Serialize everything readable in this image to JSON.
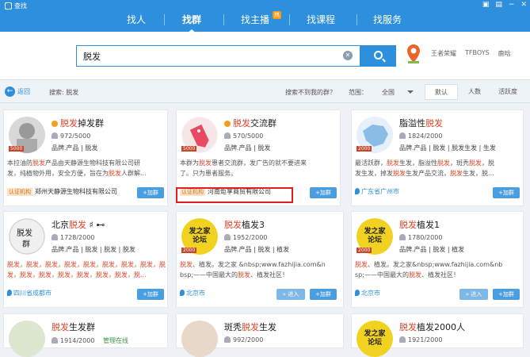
{
  "window": {
    "title": "查找",
    "controls": [
      "▣",
      "▤",
      "−",
      "✕"
    ]
  },
  "nav": {
    "tabs": [
      "找人",
      "找群",
      "找主播",
      "找课程",
      "找服务"
    ],
    "hot": "热"
  },
  "search": {
    "value": "脱发",
    "clear": "✕"
  },
  "hotwords": [
    "王者荣耀",
    "TFBOYS",
    "鹿晗"
  ],
  "filter": {
    "back": "返回",
    "crumb": "搜索: 脱发",
    "noresult": "搜索不到我的群？",
    "range_label": "范围：",
    "range_value": "全国",
    "sorts": [
      "默认",
      "人数",
      "活跃度"
    ]
  },
  "colors": {
    "accent": "#2e8fdc",
    "highlight": "#e0462a"
  },
  "cards": [
    {
      "name_hl": "脱发",
      "name_rest": "掉发群",
      "members": "972/5000",
      "tags": "品牌.产品  |  脱发",
      "badge": "5000",
      "desc1": "本拉油防脱发产品由天静源生物科技有限公司研",
      "desc2": "发，纯植物外用，安全方便，旨在为脱发人群解...",
      "cert": "认证机构",
      "org": "郑州天静源生物科技有限公司",
      "add": "+加群"
    },
    {
      "name_hl": "脱发",
      "name_rest": "交流群",
      "members": "570/5000",
      "tags": "品牌.产品  |  脱发",
      "badge": "5000",
      "desc1": "本群为脱发患者交流群，发广告的就不要进来",
      "desc2": "了。只为患者服务。",
      "cert": "认证机构",
      "org": "河南炬享商贸有限公司",
      "add": "+加群"
    },
    {
      "name_pre": "脂溢性",
      "name_hl": "脱发",
      "members": "1824/2000",
      "tags": "品牌.产品  |  脱发  |  脱发生发  |  生发",
      "badge": "2000",
      "desc1": "最活跃群，脱发生发，脂溢性脱发，斑秃脱发，脱",
      "desc2": "发生发，掉发脱发生发产品交流，脱发生发，脱...",
      "loc": "广东省广州市",
      "add": "+加群"
    },
    {
      "name_pre": "北京",
      "name_hl": "脱发",
      "name_rest": " ♯ ⊷",
      "members": "1728/2000",
      "tags": "品牌.产品  |  脱发  |  脱发  |  脱发",
      "badge": "",
      "desc1": "脱发，脱发，脱发，脱发，脱发，脱发，脱发，脱发，脱",
      "desc2": "发，脱发，脱发，脱发，脱发，脱发，脱发，脱...",
      "loc": "四川省成都市",
      "add": "+加群"
    },
    {
      "name_hl": "脱发",
      "name_rest": "植发3",
      "members": "1952/2000",
      "tags": "品牌.产品  |  脱发  |  植发",
      "badge": "2000",
      "desc1": "脱发、植发。发之家 &nbsp;www.fazhijia.com&n",
      "desc2": "bsp;——中国最大的脱发、植发社区！",
      "loc": "北京市",
      "enter": "» 进入",
      "add": "+加群"
    },
    {
      "name_hl": "脱发",
      "name_rest": "植发1",
      "members": "1780/2000",
      "tags": "品牌.产品  |  脱发  |  植发",
      "badge": "2000",
      "desc1": "脱发、植发。发之家&nbsp;www.fazhijia.com&nb",
      "desc2": "sp;——中国最大的脱发、植发社区！",
      "loc": "北京市",
      "enter": "» 进入",
      "add": "+加群"
    },
    {
      "name_hl": "脱发",
      "name_rest": "生发群",
      "members": "1914/2000",
      "extra": "管理在线"
    },
    {
      "name_pre": "斑秃",
      "name_hl": "脱发",
      "name_rest": "生发",
      "members": "992/2000"
    },
    {
      "name_hl": "脱发",
      "name_rest": "植发2000人",
      "members": "1921/2000"
    }
  ],
  "fazhi_logo": {
    "line1": "发之家",
    "line2": "论坛"
  },
  "avatar_texts": {
    "beijing_1": "脱发",
    "beijing_2": "群"
  }
}
